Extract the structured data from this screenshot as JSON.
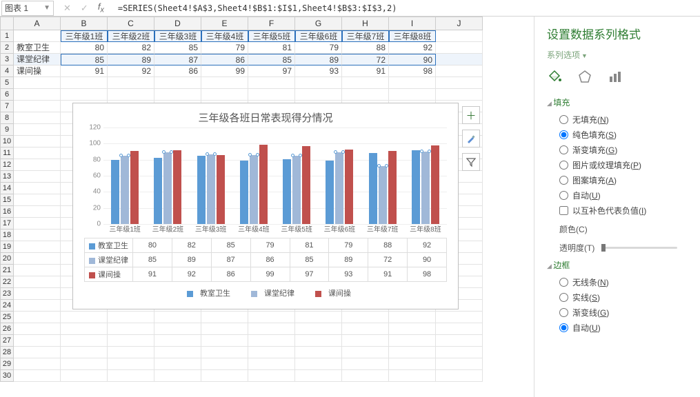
{
  "formula_bar": {
    "namebox": "图表 1",
    "formula": "=SERIES(Sheet4!$A$3,Sheet4!$B$1:$I$1,Sheet4!$B$3:$I$3,2)"
  },
  "columns": [
    "A",
    "B",
    "C",
    "D",
    "E",
    "F",
    "G",
    "H",
    "I",
    "J"
  ],
  "headers": [
    "三年级1班",
    "三年级2班",
    "三年级3班",
    "三年级4班",
    "三年级5班",
    "三年级6班",
    "三年级7班",
    "三年级8班"
  ],
  "row_labels": [
    "教室卫生",
    "课堂纪律",
    "课间操"
  ],
  "table_values": [
    [
      80,
      82,
      85,
      79,
      81,
      79,
      88,
      92
    ],
    [
      85,
      89,
      87,
      86,
      85,
      89,
      72,
      90
    ],
    [
      91,
      92,
      86,
      99,
      97,
      93,
      91,
      98
    ]
  ],
  "chart_data": {
    "type": "bar",
    "title": "三年级各班日常表现得分情况",
    "categories": [
      "三年级1班",
      "三年级2班",
      "三年级3班",
      "三年级4班",
      "三年级5班",
      "三年级6班",
      "三年级7班",
      "三年级8班"
    ],
    "series": [
      {
        "name": "教室卫生",
        "color": "#5b9bd5",
        "values": [
          80,
          82,
          85,
          79,
          81,
          79,
          88,
          92
        ]
      },
      {
        "name": "课堂纪律",
        "color": "#a0b8d8",
        "values": [
          85,
          89,
          87,
          86,
          85,
          89,
          72,
          90
        ]
      },
      {
        "name": "课间操",
        "color": "#c0504d",
        "values": [
          91,
          92,
          86,
          99,
          97,
          93,
          91,
          98
        ]
      }
    ],
    "ylim": [
      0,
      120
    ],
    "yticks": [
      0,
      20,
      40,
      60,
      80,
      100,
      120
    ]
  },
  "side_pane": {
    "title": "设置数据系列格式",
    "subtitle": "系列选项",
    "fill_header": "填充",
    "fill_opts": {
      "none": "无填充",
      "solid": "纯色填充",
      "gradient": "渐变填充",
      "picture": "图片或纹理填充",
      "pattern": "图案填充",
      "auto": "自动"
    },
    "fill_hot": {
      "none": "N",
      "solid": "S",
      "gradient": "G",
      "picture": "P",
      "pattern": "A",
      "auto": "U"
    },
    "invert_label": "以互补色代表负值",
    "invert_hot": "I",
    "color_label": "颜色",
    "color_hot": "C",
    "transparency_label": "透明度",
    "transparency_hot": "T",
    "border_header": "边框",
    "border_opts": {
      "none": "无线条",
      "solid": "实线",
      "gradient": "渐变线",
      "auto": "自动"
    },
    "border_hot": {
      "none": "N",
      "solid": "S",
      "gradient": "G",
      "auto": "U"
    }
  },
  "icons": {
    "cancel": "✕",
    "confirm": "✓",
    "fx": "fx",
    "chart_add": "＋",
    "chart_brush": "brush",
    "chart_filter": "filter",
    "paint": "paint-bucket",
    "pentagon": "pentagon",
    "bars": "bars"
  }
}
